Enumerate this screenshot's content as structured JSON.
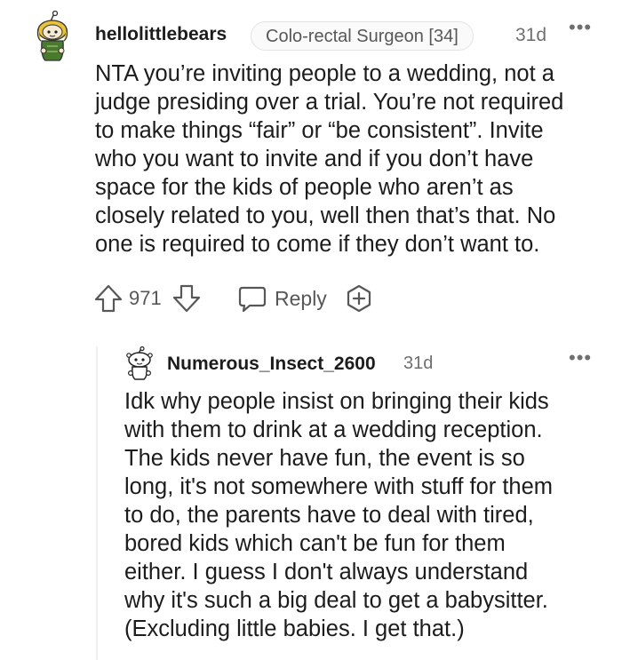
{
  "comment": {
    "username": "hellolittlebears",
    "flair": "Colo-rectal Surgeon [34]",
    "age": "31d",
    "more": "•••",
    "avatar_icon": "snoo-avatar-icon",
    "lines": [
      "NTA you’re inviting people to a wedding, not a",
      "judge presiding over a trial. You’re not required",
      "to make things “fair” or “be consistent”. Invite",
      "who you want to invite and if you don’t have",
      "space for the kids of people who aren’t as",
      "closely related to you, well then that’s that. No",
      "one is required to come if they don’t want to."
    ],
    "score": "971",
    "reply_label": "Reply",
    "upvote_icon": "upvote-arrow-icon",
    "downvote_icon": "downvote-arrow-icon",
    "reply_icon": "speech-bubble-icon",
    "award_icon": "award-plus-icon"
  },
  "reply": {
    "username": "Numerous_Insect_2600",
    "age": "31d",
    "more": "•••",
    "avatar_icon": "snoo-avatar-icon",
    "lines": [
      "Idk why people insist on bringing their kids",
      "with them to drink at a wedding reception.",
      "The kids never have fun, the event is so",
      "long, it's not somewhere with stuff for them",
      "to do, the parents have to deal with tired,",
      "bored kids which can't be fun for them",
      "either. I guess I don't always understand",
      "why it's such a big deal to get a babysitter.",
      "(Excluding little babies. I get that.)"
    ]
  },
  "colors": {
    "text": "#1c1c1c",
    "meta": "#6f6f6f",
    "icon": "#575757",
    "flair_bg": "#fafafa",
    "avatar_green": "#4a7a2e",
    "avatar_yellow": "#e8c23a"
  }
}
